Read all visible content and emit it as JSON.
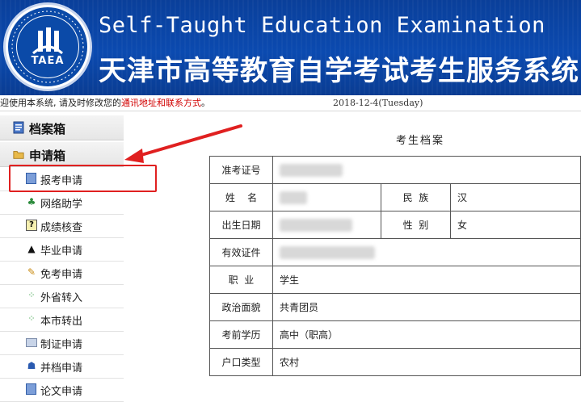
{
  "header": {
    "logo_abbr": "TAEA",
    "en_title": "Self-Taught Education Examination",
    "cn_title": "天津市高等教育自学考试考生服务系统"
  },
  "notice": {
    "prefix": "迎使用本系统, 请及时修改您的",
    "highlight": "通讯地址和联系方式",
    "suffix": "。",
    "date": "2018-12-4(Tuesday)"
  },
  "sidebar": {
    "folders": [
      {
        "label": "档案箱",
        "icon": "document-icon"
      },
      {
        "label": "申请箱",
        "icon": "folder-icon"
      }
    ],
    "items": [
      {
        "label": "报考申请",
        "icon": "form-icon"
      },
      {
        "label": "网络助学",
        "icon": "network-icon"
      },
      {
        "label": "成绩核查",
        "icon": "question-icon"
      },
      {
        "label": "毕业申请",
        "icon": "graduation-cap-icon"
      },
      {
        "label": "免考申请",
        "icon": "pencil-icon"
      },
      {
        "label": "外省转入",
        "icon": "transfer-in-icon"
      },
      {
        "label": "本市转出",
        "icon": "transfer-out-icon"
      },
      {
        "label": "制证申请",
        "icon": "card-icon"
      },
      {
        "label": "并档申请",
        "icon": "person-icon"
      },
      {
        "label": "论文申请",
        "icon": "paper-icon"
      }
    ]
  },
  "archive": {
    "title": "考生档案",
    "rows": {
      "ticket_label": "准考证号",
      "name_label": "姓    名",
      "ethnicity_label": "民  族",
      "ethnicity_value": "汉",
      "birth_label": "出生日期",
      "gender_label": "性  别",
      "gender_value": "女",
      "id_label": "有效证件",
      "job_label": "职  业",
      "job_value": "学生",
      "political_label": "政治面貌",
      "political_value": "共青团员",
      "education_label": "考前学历",
      "education_value": "高中（职高）",
      "hukou_label": "户口类型",
      "hukou_value": "农村"
    }
  },
  "colors": {
    "banner": "#0b4ab0",
    "highlight": "#e02020",
    "notice_red": "#d10000"
  }
}
